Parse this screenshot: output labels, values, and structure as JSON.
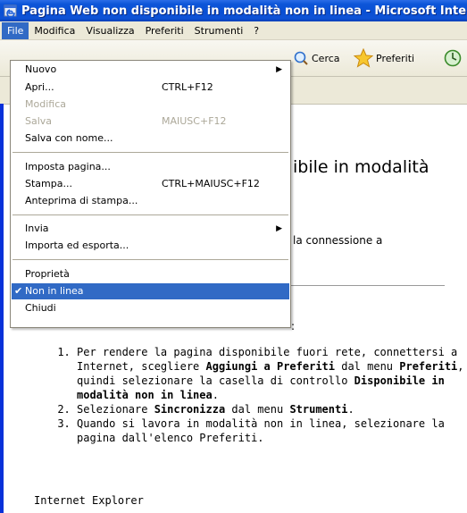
{
  "window": {
    "title": "Pagina Web non disponibile in modalità non in linea - Microsoft Internet Explorer"
  },
  "menubar": {
    "items": [
      "File",
      "Modifica",
      "Visualizza",
      "Preferiti",
      "Strumenti",
      "?"
    ]
  },
  "toolbar": {
    "search_label": "Cerca",
    "favorites_label": "Preferiti"
  },
  "file_menu": {
    "items": [
      {
        "label": "Nuovo",
        "shortcut": "",
        "submenu": true,
        "disabled": false
      },
      {
        "label": "Apri...",
        "shortcut": "CTRL+F12",
        "submenu": false,
        "disabled": false
      },
      {
        "label": "Modifica",
        "shortcut": "",
        "submenu": false,
        "disabled": true
      },
      {
        "label": "Salva",
        "shortcut": "MAIUSC+F12",
        "submenu": false,
        "disabled": true
      },
      {
        "label": "Salva con nome...",
        "shortcut": "",
        "submenu": false,
        "disabled": false
      },
      {
        "label": "Imposta pagina...",
        "shortcut": "",
        "submenu": false,
        "disabled": false
      },
      {
        "label": "Stampa...",
        "shortcut": "CTRL+MAIUSC+F12",
        "submenu": false,
        "disabled": false
      },
      {
        "label": "Anteprima di stampa...",
        "shortcut": "",
        "submenu": false,
        "disabled": false
      },
      {
        "label": "Invia",
        "shortcut": "",
        "submenu": true,
        "disabled": false
      },
      {
        "label": "Importa ed esporta...",
        "shortcut": "",
        "submenu": false,
        "disabled": false
      },
      {
        "label": "Proprietà",
        "shortcut": "",
        "submenu": false,
        "disabled": false
      },
      {
        "label": "Non in linea",
        "shortcut": "",
        "submenu": false,
        "disabled": false,
        "checked": true,
        "selected": true
      },
      {
        "label": "Chiudi",
        "shortcut": "",
        "submenu": false,
        "disabled": false
      }
    ]
  },
  "page": {
    "heading_partial": "ibile in modalità",
    "subtext_partial": "la connessione a",
    "colon": ":",
    "steps": [
      {
        "parts": [
          {
            "t": "Per rendere la pagina disponibile fuori rete, connettersi a Internet, scegliere ",
            "b": false
          },
          {
            "t": "Aggiungi a Preferiti",
            "b": true
          },
          {
            "t": " dal menu ",
            "b": false
          },
          {
            "t": "Preferiti",
            "b": true
          },
          {
            "t": ", quindi selezionare la casella di controllo ",
            "b": false
          },
          {
            "t": "Disponibile in modalità non in linea",
            "b": true
          },
          {
            "t": ".",
            "b": false
          }
        ]
      },
      {
        "parts": [
          {
            "t": "Selezionare ",
            "b": false
          },
          {
            "t": "Sincronizza",
            "b": true
          },
          {
            "t": " dal menu ",
            "b": false
          },
          {
            "t": "Strumenti",
            "b": true
          },
          {
            "t": ".",
            "b": false
          }
        ]
      },
      {
        "parts": [
          {
            "t": "Quando si lavora in modalità non in linea, selezionare la pagina dall'elenco Preferiti.",
            "b": false
          }
        ]
      }
    ],
    "footer": "Internet Explorer"
  },
  "colors": {
    "titlebar": "#0a4fd3",
    "menu_highlight": "#316ac5",
    "menubar_bg": "#ece9d8",
    "disabled_text": "#aca899"
  }
}
